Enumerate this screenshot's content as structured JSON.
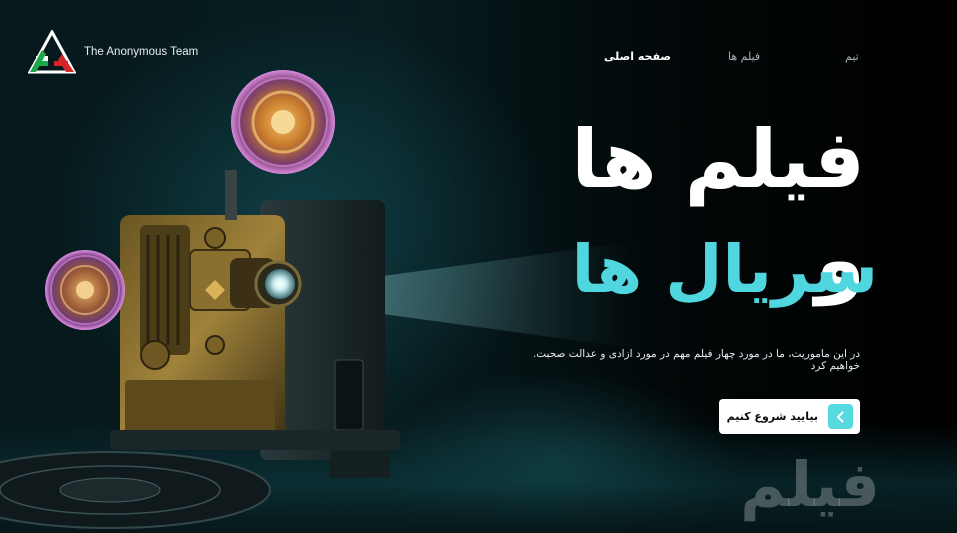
{
  "brand": {
    "name": "The Anonymous Team",
    "logo_icon": "triangle-flag-logo"
  },
  "nav": {
    "home": "صفحه اصلی",
    "movies": "فیلم ها",
    "team": "تیم"
  },
  "hero": {
    "title_line1": "فیلم ها و",
    "title_line2": "سریال ها",
    "description": ".در این ماموریت، ما در مورد چهار فیلم مهم در مورد ازادی و عدالت صحبت خواهیم کرد",
    "cta_label": "بیایید شروع کنیم",
    "cta_icon": "chevron-left-icon",
    "watermark": "فیلم"
  },
  "colors": {
    "accent": "#4fd6df",
    "background": "#030809",
    "cta_bg": "#ffffff"
  }
}
